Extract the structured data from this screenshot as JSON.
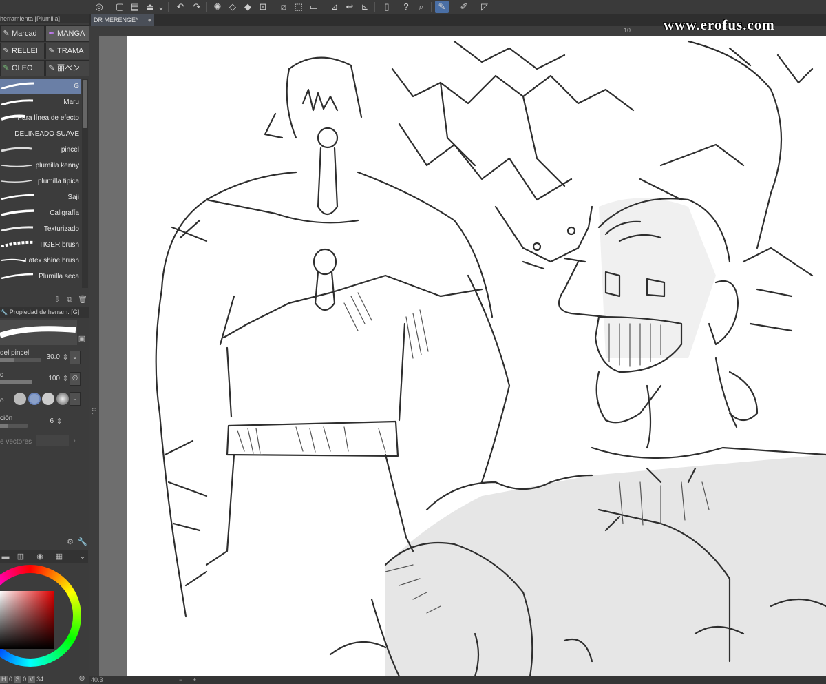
{
  "app": {
    "accent": "#4a6fa5",
    "selected_brush_color": "#6a7fa6",
    "canvas_color": "#ffffff"
  },
  "tool_panel": {
    "title": "herramienta [Plumilla]",
    "tabs": [
      {
        "label": "Marcad",
        "icon": "marker-icon"
      },
      {
        "label": "MANGA",
        "icon": "manga-pen-icon"
      },
      {
        "label": "RELLEI",
        "icon": "fill-pen-icon"
      },
      {
        "label": "TRAMA",
        "icon": "screentone-pen-icon"
      },
      {
        "label": "OLEO",
        "icon": "oil-pen-icon"
      },
      {
        "label": "丽ペン",
        "icon": "pen-icon"
      }
    ],
    "brushes": [
      {
        "label": "G",
        "selected": true
      },
      {
        "label": "Maru"
      },
      {
        "label": "Para línea de efecto"
      },
      {
        "label": "DELINEADO SUAVE"
      },
      {
        "label": "pincel"
      },
      {
        "label": "plumilla kenny"
      },
      {
        "label": "plumilla tipica"
      },
      {
        "label": "Saji"
      },
      {
        "label": "Caligrafía"
      },
      {
        "label": "Texturizado"
      },
      {
        "label": "TIGER brush"
      },
      {
        "label": "Latex shine brush"
      },
      {
        "label": "Plumilla seca"
      }
    ]
  },
  "properties": {
    "header": "Propiedad de herram. [G]",
    "brush_size_label": "del pincel",
    "brush_size_value": "30.0",
    "opacity_label": "d",
    "opacity_value": "100",
    "tip_label": "o",
    "stabilization_label": "ción",
    "stabilization_value": "6",
    "vector_label": "e vectores"
  },
  "document": {
    "tab_title": "DR MERENGE*",
    "ruler_top_mark": "10",
    "ruler_left_mark": "10",
    "zoom": "40.3"
  },
  "color_panel": {
    "hsv": [
      "H",
      "0",
      "S",
      "0",
      "V",
      "34"
    ]
  },
  "watermark": "www.erofus.com"
}
